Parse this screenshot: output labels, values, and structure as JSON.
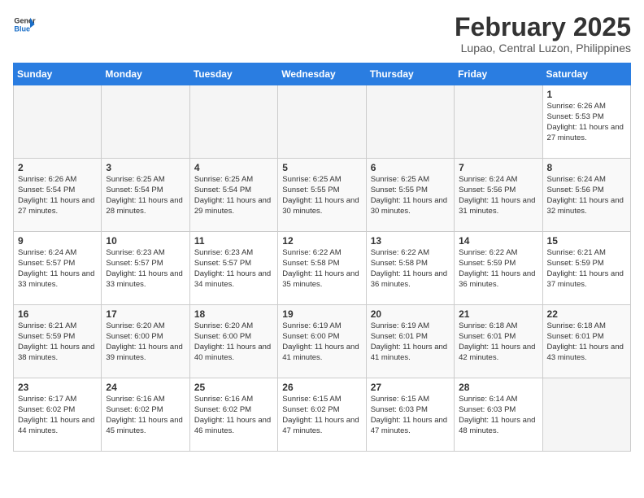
{
  "header": {
    "logo_line1": "General",
    "logo_line2": "Blue",
    "title": "February 2025",
    "subtitle": "Lupao, Central Luzon, Philippines"
  },
  "columns": [
    "Sunday",
    "Monday",
    "Tuesday",
    "Wednesday",
    "Thursday",
    "Friday",
    "Saturday"
  ],
  "weeks": [
    [
      {
        "day": "",
        "info": ""
      },
      {
        "day": "",
        "info": ""
      },
      {
        "day": "",
        "info": ""
      },
      {
        "day": "",
        "info": ""
      },
      {
        "day": "",
        "info": ""
      },
      {
        "day": "",
        "info": ""
      },
      {
        "day": "1",
        "info": "Sunrise: 6:26 AM\nSunset: 5:53 PM\nDaylight: 11 hours and 27 minutes."
      }
    ],
    [
      {
        "day": "2",
        "info": "Sunrise: 6:26 AM\nSunset: 5:54 PM\nDaylight: 11 hours and 27 minutes."
      },
      {
        "day": "3",
        "info": "Sunrise: 6:25 AM\nSunset: 5:54 PM\nDaylight: 11 hours and 28 minutes."
      },
      {
        "day": "4",
        "info": "Sunrise: 6:25 AM\nSunset: 5:54 PM\nDaylight: 11 hours and 29 minutes."
      },
      {
        "day": "5",
        "info": "Sunrise: 6:25 AM\nSunset: 5:55 PM\nDaylight: 11 hours and 30 minutes."
      },
      {
        "day": "6",
        "info": "Sunrise: 6:25 AM\nSunset: 5:55 PM\nDaylight: 11 hours and 30 minutes."
      },
      {
        "day": "7",
        "info": "Sunrise: 6:24 AM\nSunset: 5:56 PM\nDaylight: 11 hours and 31 minutes."
      },
      {
        "day": "8",
        "info": "Sunrise: 6:24 AM\nSunset: 5:56 PM\nDaylight: 11 hours and 32 minutes."
      }
    ],
    [
      {
        "day": "9",
        "info": "Sunrise: 6:24 AM\nSunset: 5:57 PM\nDaylight: 11 hours and 33 minutes."
      },
      {
        "day": "10",
        "info": "Sunrise: 6:23 AM\nSunset: 5:57 PM\nDaylight: 11 hours and 33 minutes."
      },
      {
        "day": "11",
        "info": "Sunrise: 6:23 AM\nSunset: 5:57 PM\nDaylight: 11 hours and 34 minutes."
      },
      {
        "day": "12",
        "info": "Sunrise: 6:22 AM\nSunset: 5:58 PM\nDaylight: 11 hours and 35 minutes."
      },
      {
        "day": "13",
        "info": "Sunrise: 6:22 AM\nSunset: 5:58 PM\nDaylight: 11 hours and 36 minutes."
      },
      {
        "day": "14",
        "info": "Sunrise: 6:22 AM\nSunset: 5:59 PM\nDaylight: 11 hours and 36 minutes."
      },
      {
        "day": "15",
        "info": "Sunrise: 6:21 AM\nSunset: 5:59 PM\nDaylight: 11 hours and 37 minutes."
      }
    ],
    [
      {
        "day": "16",
        "info": "Sunrise: 6:21 AM\nSunset: 5:59 PM\nDaylight: 11 hours and 38 minutes."
      },
      {
        "day": "17",
        "info": "Sunrise: 6:20 AM\nSunset: 6:00 PM\nDaylight: 11 hours and 39 minutes."
      },
      {
        "day": "18",
        "info": "Sunrise: 6:20 AM\nSunset: 6:00 PM\nDaylight: 11 hours and 40 minutes."
      },
      {
        "day": "19",
        "info": "Sunrise: 6:19 AM\nSunset: 6:00 PM\nDaylight: 11 hours and 41 minutes."
      },
      {
        "day": "20",
        "info": "Sunrise: 6:19 AM\nSunset: 6:01 PM\nDaylight: 11 hours and 41 minutes."
      },
      {
        "day": "21",
        "info": "Sunrise: 6:18 AM\nSunset: 6:01 PM\nDaylight: 11 hours and 42 minutes."
      },
      {
        "day": "22",
        "info": "Sunrise: 6:18 AM\nSunset: 6:01 PM\nDaylight: 11 hours and 43 minutes."
      }
    ],
    [
      {
        "day": "23",
        "info": "Sunrise: 6:17 AM\nSunset: 6:02 PM\nDaylight: 11 hours and 44 minutes."
      },
      {
        "day": "24",
        "info": "Sunrise: 6:16 AM\nSunset: 6:02 PM\nDaylight: 11 hours and 45 minutes."
      },
      {
        "day": "25",
        "info": "Sunrise: 6:16 AM\nSunset: 6:02 PM\nDaylight: 11 hours and 46 minutes."
      },
      {
        "day": "26",
        "info": "Sunrise: 6:15 AM\nSunset: 6:02 PM\nDaylight: 11 hours and 47 minutes."
      },
      {
        "day": "27",
        "info": "Sunrise: 6:15 AM\nSunset: 6:03 PM\nDaylight: 11 hours and 47 minutes."
      },
      {
        "day": "28",
        "info": "Sunrise: 6:14 AM\nSunset: 6:03 PM\nDaylight: 11 hours and 48 minutes."
      },
      {
        "day": "",
        "info": ""
      }
    ]
  ]
}
